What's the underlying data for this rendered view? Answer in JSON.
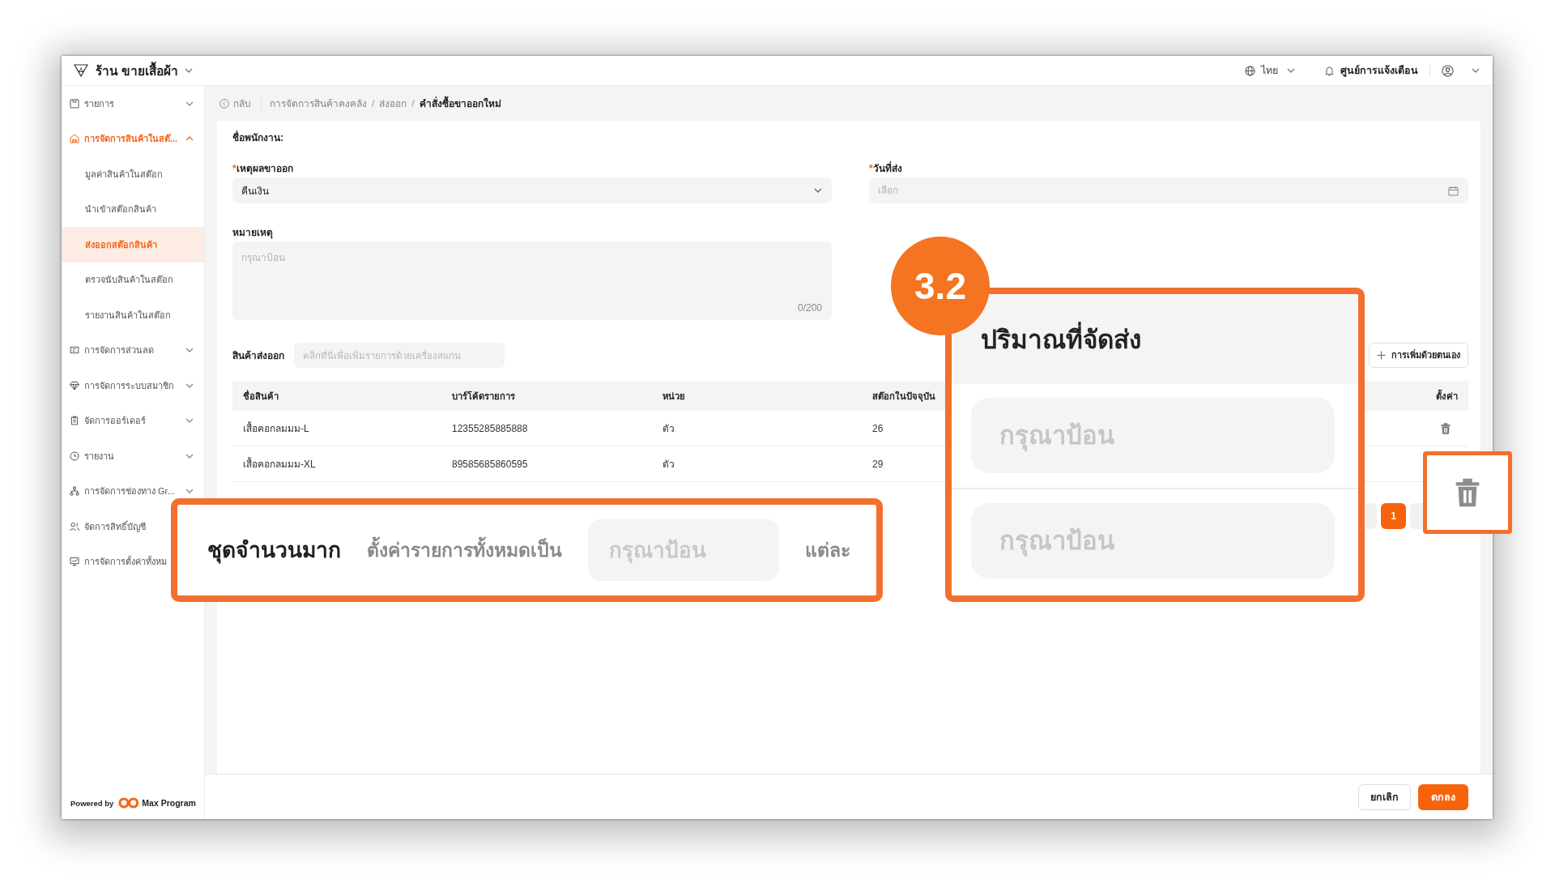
{
  "app_bar": {
    "store_name": "ร้าน ขายเสื้อผ้า",
    "language": "ไทย",
    "notification_center": "ศูนย์การแจ้งเตือน"
  },
  "sidebar": {
    "items": [
      {
        "label": "รายการ",
        "active": false,
        "expanded": false
      },
      {
        "label": "การจัดการสินค้าในสต๊...",
        "active": true,
        "expanded": true,
        "children": [
          {
            "label": "มูลค่าสินค้าในสต๊อก",
            "selected": false
          },
          {
            "label": "นำเข้าสต๊อกสินค้า",
            "selected": false
          },
          {
            "label": "ส่งออกสต๊อกสินค้า",
            "selected": true
          },
          {
            "label": "ตรวจนับสินค้าในสต๊อก",
            "selected": false
          },
          {
            "label": "รายงานสินค้าในสต๊อก",
            "selected": false
          }
        ]
      },
      {
        "label": "การจัดการส่วนลด",
        "active": false,
        "expanded": false
      },
      {
        "label": "การจัดการระบบสมาชิก",
        "active": false,
        "expanded": false
      },
      {
        "label": "จัดการออร์เดอร์",
        "active": false,
        "expanded": false
      },
      {
        "label": "รายงาน",
        "active": false,
        "expanded": false
      },
      {
        "label": "การจัดการช่องทาง Gr...",
        "active": false,
        "expanded": false
      },
      {
        "label": "จัดการสิทธิ์บัญชี",
        "active": false
      },
      {
        "label": "การจัดการตั้งค่าทั้งหม",
        "active": false
      }
    ],
    "powered_by": "Powered by",
    "brand": "Max Program"
  },
  "breadcrumb": {
    "back": "กลับ",
    "path": [
      {
        "label": "การจัดการสินค้าคงคลัง",
        "current": false
      },
      {
        "separator": "/",
        "label": "ส่งออก",
        "current": false
      },
      {
        "separator": "/",
        "label": "คำสั่งซื้อขาออกใหม่",
        "current": true
      }
    ]
  },
  "form": {
    "employee_label": "ชื่อพนักงาน:",
    "fields": [
      {
        "kind": "select",
        "required_mark": "*",
        "label": "เหตุผลขาออก",
        "value": "คืนเงิน"
      },
      {
        "kind": "date",
        "required_mark": "*",
        "label": "วันที่ส่ง",
        "placeholder": "เลือก"
      },
      {
        "kind": "textarea",
        "label": "หมายเหตุ",
        "placeholder": "กรุณาป้อน",
        "counter": "0/200"
      }
    ]
  },
  "products": {
    "label": "สินค้าส่งออก",
    "scan_placeholder": "คลิกที่นี่เพื่อเพิ่มรายการด้วยเครื่องสแกน",
    "manual_add": "การเพิ่มด้วยตนเอง",
    "table": {
      "columns": [
        "ชื่อสินค้า",
        "บาร์โค้ดรายการ",
        "หน่วย",
        "สต๊อกในปัจจุบัน",
        "ตั้งค่า"
      ],
      "rows": [
        {
          "cells": [
            "เสื้อคอกลมมม-L",
            "12355285885888",
            "ตัว",
            "26"
          ],
          "delete_visible": true
        },
        {
          "cells": [
            "เสื้อคอกลมมม-XL",
            "89585685860595",
            "ตัว",
            "29"
          ]
        }
      ]
    },
    "pagination": {
      "pages": [
        {
          "label": "1",
          "selected": true
        }
      ]
    }
  },
  "footer": {
    "buttons": [
      {
        "kind": "secondary",
        "label": "ยกเลิก"
      },
      {
        "kind": "primary",
        "label": "ตกลง"
      }
    ]
  },
  "callouts": {
    "step_badge": "3.2",
    "quantity": {
      "title": "ปริมาณที่จัดส่ง",
      "inputs": [
        {
          "placeholder": "กรุณาป้อน"
        },
        {
          "placeholder": "กรุณาป้อน"
        }
      ]
    },
    "bulk": {
      "title": "ชุดจำนวนมาก",
      "text": "ตั้งค่ารายการทั้งหมดเป็น",
      "placeholder": "กรุณาป้อน",
      "suffix": "แต่ละ"
    }
  }
}
